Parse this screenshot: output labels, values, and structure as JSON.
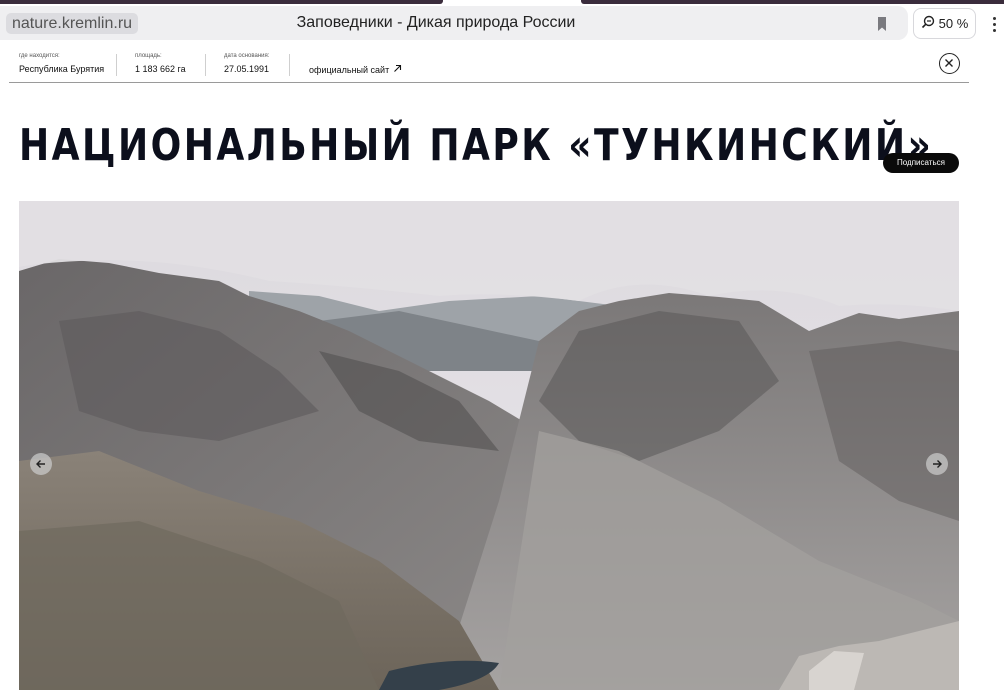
{
  "browser": {
    "url": "nature.kremlin.ru",
    "page_title": "Заповедники - Дикая природа России",
    "zoom": "50 %",
    "icons": {
      "bookmark": "bookmark-icon",
      "zoom": "zoom-icon",
      "more": "more-vertical-icon"
    }
  },
  "infobar": {
    "location_label": "где находится:",
    "location_value": "Республика Бурятия",
    "area_label": "площадь:",
    "area_value": "1 183 662 га",
    "founded_label": "дата основания:",
    "founded_value": "27.05.1991",
    "site_link": "официальный сайт",
    "icons": {
      "external": "arrow-up-right-icon",
      "close": "close-icon"
    }
  },
  "park": {
    "title": "НАЦИОНАЛЬНЫЙ ПАРК «ТУНКИНСКИЙ»",
    "subscribe": "Подписаться"
  },
  "gallery": {
    "image": "mountain-valley-photo",
    "icons": {
      "prev": "arrow-left-icon",
      "next": "arrow-right-icon"
    }
  },
  "colors": {
    "title": "#0c0f1c",
    "subscribe_bg": "#0a0a0a",
    "chrome_bg": "#efeff1"
  }
}
